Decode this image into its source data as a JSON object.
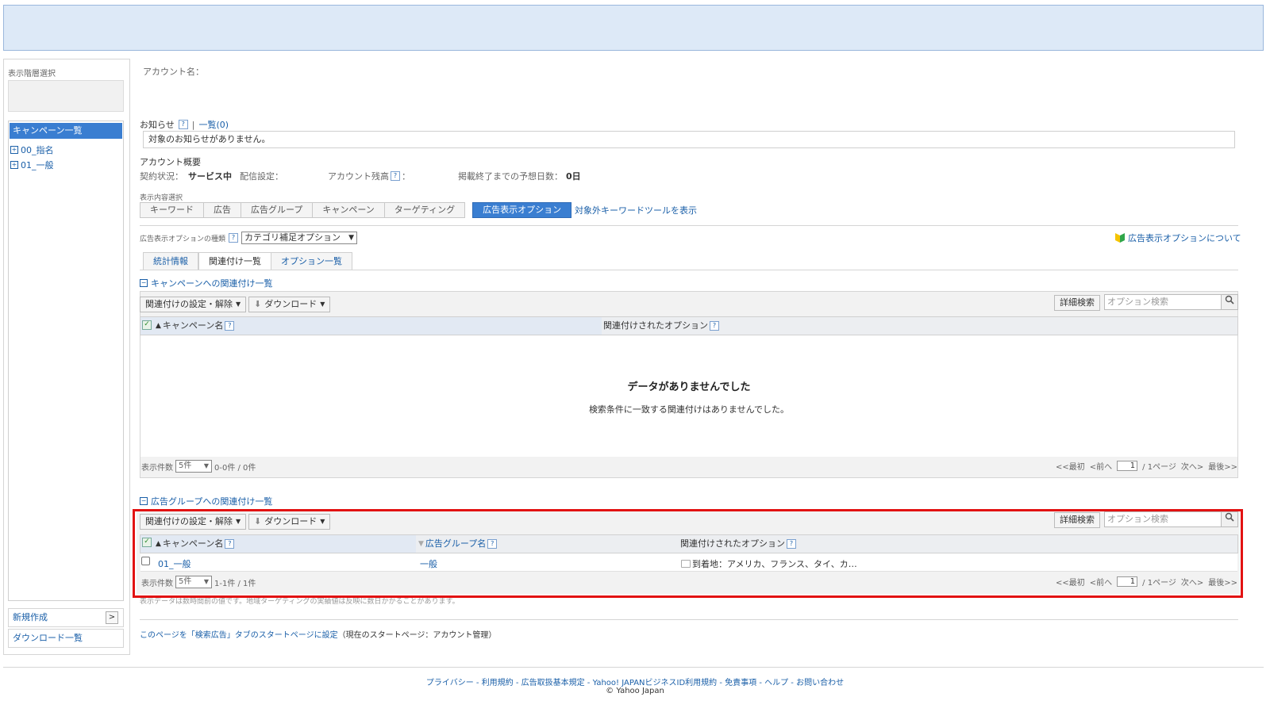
{
  "sidebar": {
    "title": "表示階層選択",
    "list_header": "キャンペーン一覧",
    "items": [
      {
        "label": "00_指名"
      },
      {
        "label": "01_一般"
      }
    ],
    "new_create": "新規作成",
    "download_list": "ダウンロード一覧"
  },
  "account": {
    "name_label": "アカウント名："
  },
  "notice": {
    "label": "お知らせ",
    "list_link": "一覧(0)",
    "message": "対象のお知らせがありません。"
  },
  "summary": {
    "title": "アカウント概要",
    "contract_label": "契約状況：",
    "contract_value": "サービス中",
    "delivery_label": "配信設定：",
    "balance_label": "アカウント残高",
    "days_label": "掲載終了までの予想日数：",
    "days_value": "0日"
  },
  "display_select": {
    "label": "表示内容選択",
    "tabs": [
      "キーワード",
      "広告",
      "広告グループ",
      "キャンペーン",
      "ターゲティング"
    ],
    "active_tab": "広告表示オプション",
    "tool_link": "対象外キーワードツールを表示"
  },
  "option_type": {
    "label": "広告表示オプションの種類",
    "selected": "カテゴリ補足オプション",
    "about_link": "広告表示オプションについて"
  },
  "subtabs": [
    "統計情報",
    "関連付け一覧",
    "オプション一覧"
  ],
  "campaign_section": {
    "title": "キャンペーンへの関連付け一覧",
    "set_button": "関連付けの設定・解除",
    "download_button": "ダウンロード",
    "detail_search": "詳細検索",
    "search_placeholder": "オプション検索",
    "col_campaign": "キャンペーン名",
    "col_option": "関連付けされたオプション",
    "empty_title": "データがありませんでした",
    "empty_desc": "検索条件に一致する関連付けはありませんでした。",
    "count_label": "表示件数",
    "page_size": "5件",
    "range": "0-0件 / 0件",
    "pager": {
      "first": "<<最初",
      "prev": "<前へ",
      "page": "1",
      "pages": "/ 1ページ",
      "next": "次へ>",
      "last": "最後>>"
    }
  },
  "adgroup_section": {
    "title": "広告グループへの関連付け一覧",
    "set_button": "関連付けの設定・解除",
    "download_button": "ダウンロード",
    "detail_search": "詳細検索",
    "search_placeholder": "オプション検索",
    "col_campaign": "キャンペーン名",
    "col_adgroup": "広告グループ名",
    "col_option": "関連付けされたオプション",
    "rows": [
      {
        "campaign": "01_一般",
        "adgroup": "一般",
        "option": "到着地：アメリカ、フランス、タイ、カ…"
      }
    ],
    "count_label": "表示件数",
    "page_size": "5件",
    "range": "1-1件 / 1件",
    "pager": {
      "first": "<<最初",
      "prev": "<前へ",
      "page": "1",
      "pages": "/ 1ページ",
      "next": "次へ>",
      "last": "最後>>"
    }
  },
  "note": "表示データは数時間前の値です。地域ターゲティングの実績値は反映に数日かかることがあります。",
  "startpage": {
    "link": "このページを「検索広告」タブのスタートページに設定",
    "current": "（現在のスタートページ：アカウント管理）"
  },
  "footer": {
    "links": "プライバシー - 利用規約 - 広告取扱基本規定 - Yahoo! JAPANビジネスID利用規約 - 免責事項 - ヘルプ - お問い合わせ",
    "copyright": "© Yahoo Japan"
  },
  "colors": {
    "accent": "#3a7ed1",
    "highlight": "#e21212"
  }
}
